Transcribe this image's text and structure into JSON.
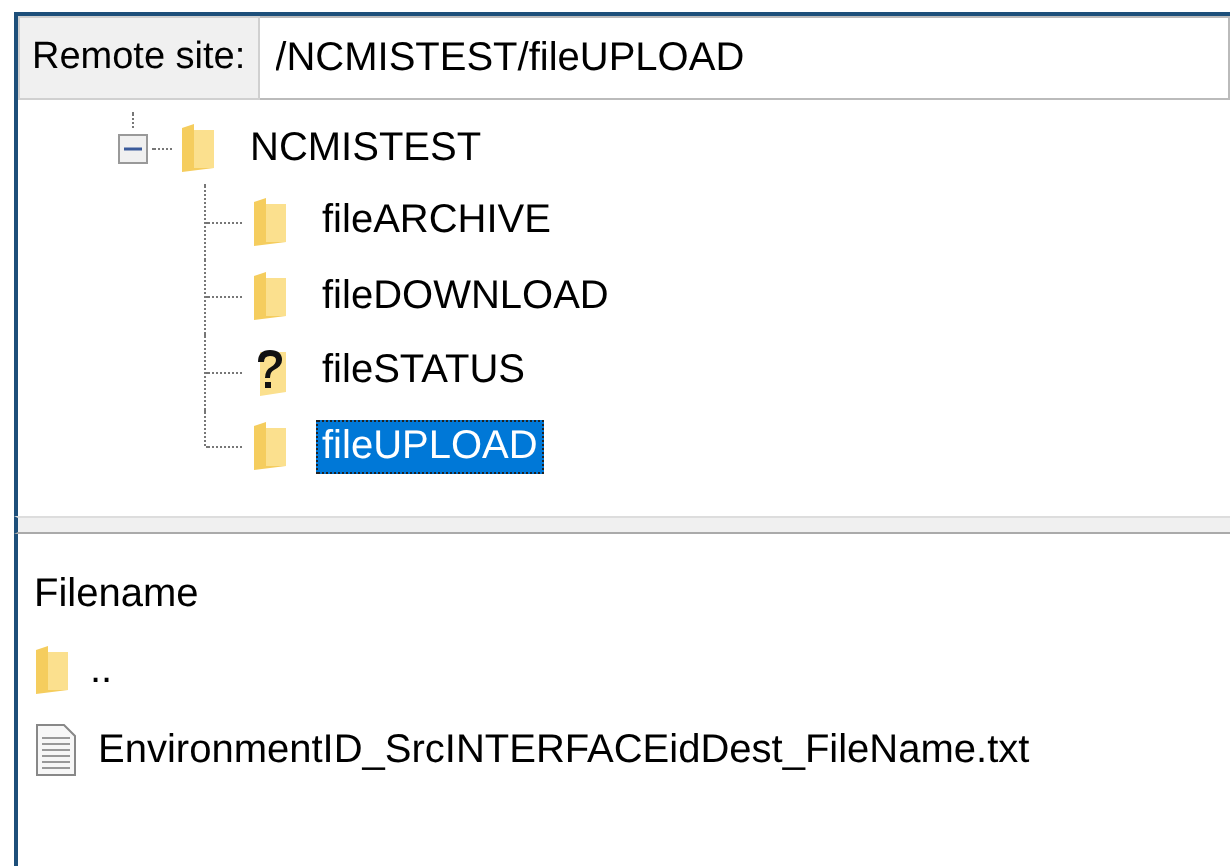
{
  "remote_site": {
    "label": "Remote site:",
    "value": "/NCMISTEST/fileUPLOAD"
  },
  "tree": {
    "label": "NCMISTEST",
    "expanded": true,
    "children": [
      {
        "label": "fileARCHIVE",
        "kind": "folder",
        "selected": false
      },
      {
        "label": "fileDOWNLOAD",
        "kind": "folder",
        "selected": false
      },
      {
        "label": "fileSTATUS",
        "kind": "unknown",
        "selected": false
      },
      {
        "label": "fileUPLOAD",
        "kind": "folder",
        "selected": true
      }
    ]
  },
  "file_list": {
    "columns": [
      "Filename"
    ],
    "rows": [
      {
        "name": "..",
        "kind": "folder"
      },
      {
        "name": "EnvironmentID_SrcINTERFACEidDest_FileName.txt",
        "kind": "file"
      }
    ]
  }
}
